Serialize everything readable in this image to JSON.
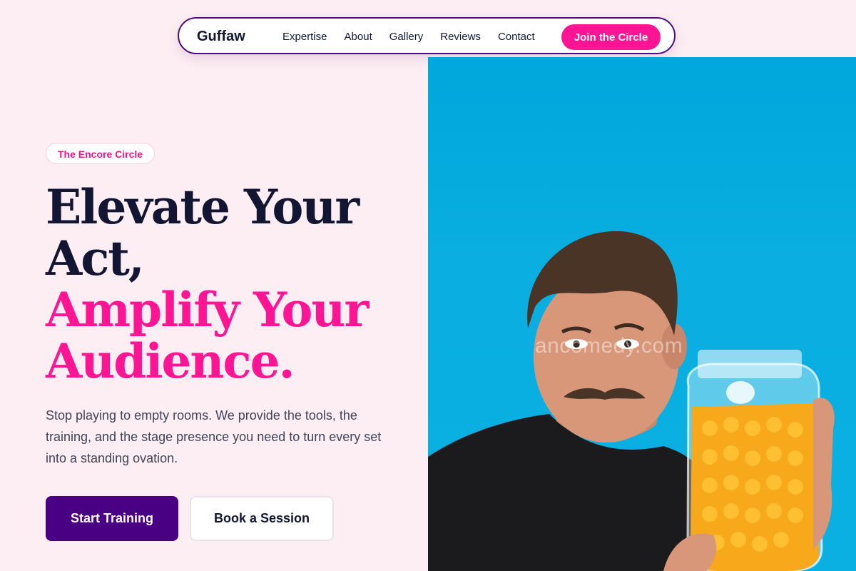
{
  "nav": {
    "brand": "Guffaw",
    "links": [
      "Expertise",
      "About",
      "Gallery",
      "Reviews",
      "Contact"
    ],
    "cta": "Join the Circle"
  },
  "hero": {
    "badge": "The Encore Circle",
    "headline_line1": "Elevate Your",
    "headline_line2": "Act,",
    "headline_line3": "Amplify Your",
    "headline_line4": "Audience.",
    "lead": "Stop playing to empty rooms. We provide the tools, the training, and the stage presence you need to turn every set into a standing ovation.",
    "primary_cta": "Start Training",
    "secondary_cta": "Book a Session"
  },
  "photo": {
    "watermark": "ancomedy.com"
  },
  "colors": {
    "accent": "#ff1493",
    "primary": "#4a0082",
    "background": "#fdeef3",
    "photo_bg": "#0bb0e2"
  }
}
